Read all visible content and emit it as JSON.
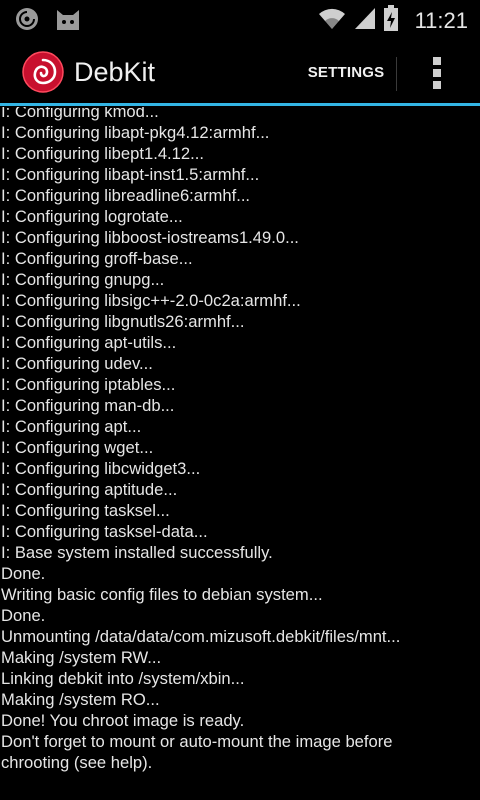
{
  "status_bar": {
    "time": "11:21",
    "icons": [
      "debian-swirl-icon",
      "cat-face-icon",
      "wifi-icon",
      "signal-icon",
      "battery-charging-icon"
    ]
  },
  "action_bar": {
    "title": "DebKit",
    "settings_label": "SETTINGS",
    "accent_color": "#33b5e5",
    "icon": "debkit-app-icon",
    "overflow_icon": "overflow-menu-icon"
  },
  "console": {
    "lines": [
      "I: Configuring kmod...",
      "I: Configuring libapt-pkg4.12:armhf...",
      "I: Configuring libept1.4.12...",
      "I: Configuring libapt-inst1.5:armhf...",
      "I: Configuring libreadline6:armhf...",
      "I: Configuring logrotate...",
      "I: Configuring libboost-iostreams1.49.0...",
      "I: Configuring groff-base...",
      "I: Configuring gnupg...",
      "I: Configuring libsigc++-2.0-0c2a:armhf...",
      "I: Configuring libgnutls26:armhf...",
      "I: Configuring apt-utils...",
      "I: Configuring udev...",
      "I: Configuring iptables...",
      "I: Configuring man-db...",
      "I: Configuring apt...",
      "I: Configuring wget...",
      "I: Configuring libcwidget3...",
      "I: Configuring aptitude...",
      "I: Configuring tasksel...",
      "I: Configuring tasksel-data...",
      "I: Base system installed successfully.",
      "Done.",
      "Writing basic config files to debian system...",
      "Done.",
      "Unmounting /data/data/com.mizusoft.debkit/files/mnt...",
      "Making /system RW...",
      "Linking debkit into /system/xbin...",
      "Making /system RO...",
      "Done! You chroot image is ready.",
      "Don't forget to mount or auto-mount the image before chrooting (see help)."
    ]
  }
}
